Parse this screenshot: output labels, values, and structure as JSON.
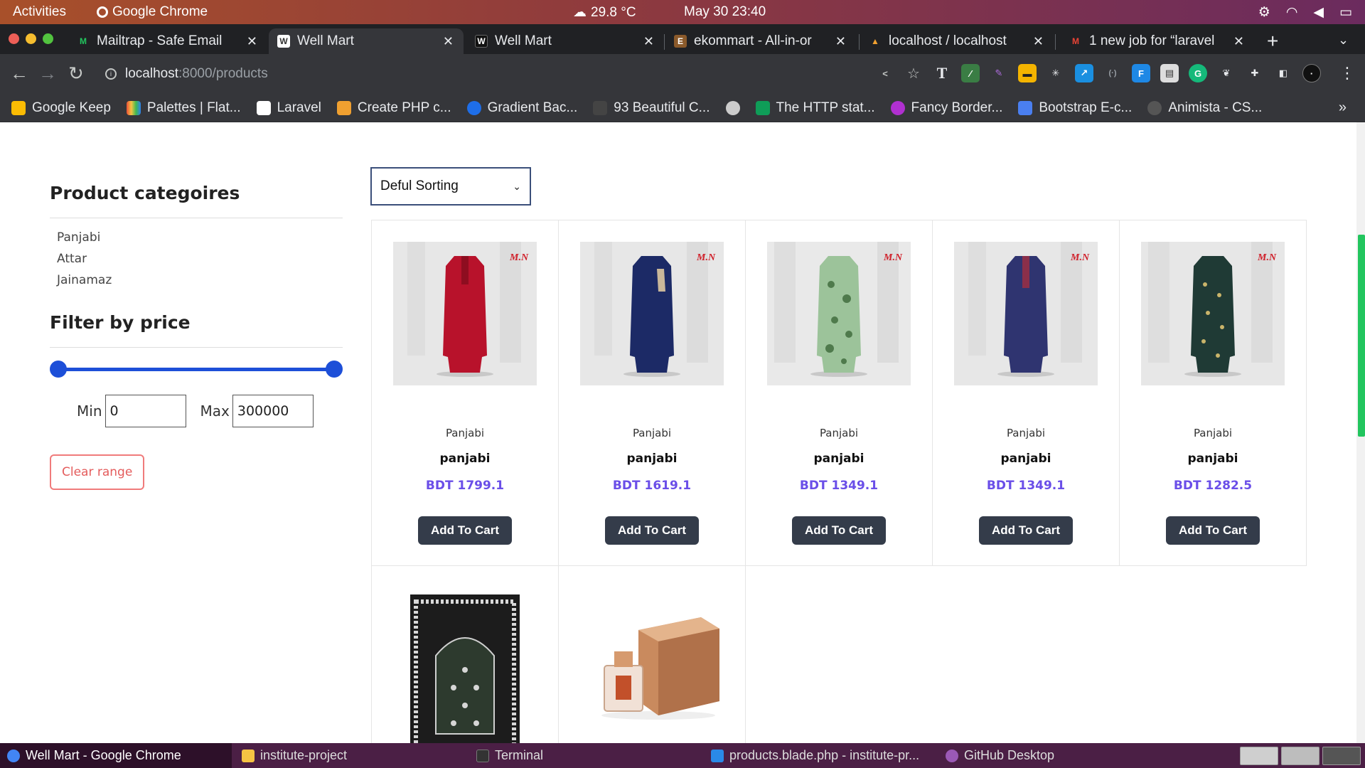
{
  "topbar": {
    "activities": "Activities",
    "app": "Google Chrome",
    "weather": "29.8 °C",
    "clock": "May 30  23:40"
  },
  "tabs": [
    {
      "title": "Mailtrap - Safe Email",
      "icon": "mailtrap-icon",
      "color": "#22c55e"
    },
    {
      "title": "Well Mart",
      "icon": "wellmart-icon",
      "color": "#ffffff",
      "active": true
    },
    {
      "title": "Well Mart",
      "icon": "wellmart-icon",
      "color": "#111111"
    },
    {
      "title": "ekommart - All-in-or",
      "icon": "ekommart-icon",
      "color": "#8b5a2b"
    },
    {
      "title": "localhost / localhost",
      "icon": "phpmyadmin-icon",
      "color": "#f0a030"
    },
    {
      "title": "1 new job for “laravel",
      "icon": "gmail-icon",
      "color": "#ea4335"
    }
  ],
  "toolbar": {
    "url_host": "localhost",
    "url_path": ":8000/products"
  },
  "bookmarks": [
    {
      "label": "Google Keep",
      "color": "#fbbc04"
    },
    {
      "label": "Palettes | Flat...",
      "color": "#e94f37"
    },
    {
      "label": "Laravel",
      "color": "#ffffff"
    },
    {
      "label": "Create PHP c...",
      "color": "#f0a030"
    },
    {
      "label": "Gradient Bac...",
      "color": "#1e6ee8"
    },
    {
      "label": "93 Beautiful C...",
      "color": "#444444"
    },
    {
      "label": "",
      "color": "#cccccc"
    },
    {
      "label": "The HTTP stat...",
      "color": "#0f9d58"
    },
    {
      "label": "Fancy Border...",
      "color": "#b030d0"
    },
    {
      "label": "Bootstrap E-c...",
      "color": "#4a7ff0"
    },
    {
      "label": "Animista - CS...",
      "color": "#555555"
    }
  ],
  "sidebar": {
    "categories_title": "Product categoires",
    "categories": [
      "Panjabi",
      "Attar",
      "Jainamaz"
    ],
    "price_title": "Filter by price",
    "price_min_fraction": 0,
    "price_max_fraction": 1,
    "min_label": "Min",
    "max_label": "Max",
    "min_value": "0",
    "max_value": "300000",
    "clear_label": "Clear range"
  },
  "sorting": {
    "selected": "Deful Sorting"
  },
  "products": [
    {
      "category": "Panjabi",
      "name": "panjabi",
      "price": "BDT 1799.1",
      "button": "Add To Cart",
      "garment_color": "#b8122b",
      "image": "red-panjabi"
    },
    {
      "category": "Panjabi",
      "name": "panjabi",
      "price": "BDT 1619.1",
      "button": "Add To Cart",
      "garment_color": "#1c2a66",
      "image": "navy-panjabi"
    },
    {
      "category": "Panjabi",
      "name": "panjabi",
      "price": "BDT 1349.1",
      "button": "Add To Cart",
      "garment_color": "#9cc39a",
      "image": "green-print-panjabi"
    },
    {
      "category": "Panjabi",
      "name": "panjabi",
      "price": "BDT 1349.1",
      "button": "Add To Cart",
      "garment_color": "#2f3470",
      "image": "indigo-panjabi"
    },
    {
      "category": "Panjabi",
      "name": "panjabi",
      "price": "BDT 1282.5",
      "button": "Add To Cart",
      "garment_color": "#1f3a35",
      "image": "teal-print-panjabi"
    },
    {
      "image": "jainamaz-prayer-mat"
    },
    {
      "image": "attar-perfume-box"
    }
  ],
  "brand_mark": "M.N",
  "taskbar": [
    {
      "label": "Well Mart - Google Chrome",
      "color": "#4285f4",
      "active": true
    },
    {
      "label": "institute-project",
      "color": "#f6c343"
    },
    {
      "label": "Terminal",
      "color": "#333333"
    },
    {
      "label": "products.blade.php - institute-pr...",
      "color": "#2a8ae8"
    },
    {
      "label": "GitHub Desktop",
      "color": "#9b59b6"
    }
  ]
}
